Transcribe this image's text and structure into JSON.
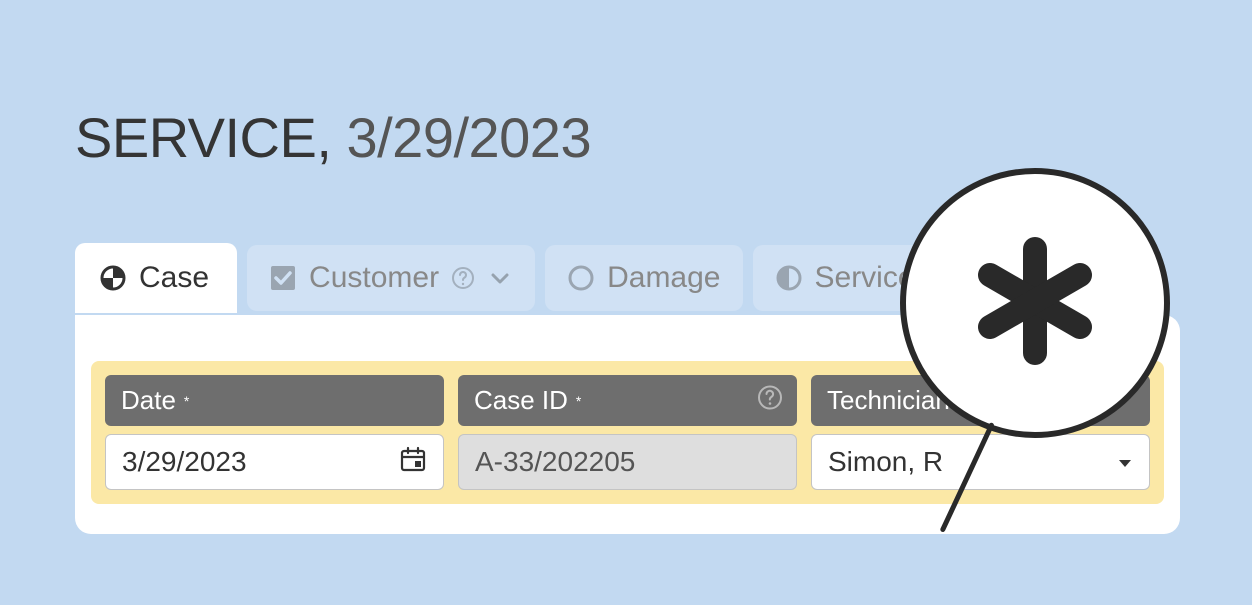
{
  "header": {
    "title_prefix": "SERVICE,",
    "title_date": "3/29/2023"
  },
  "tabs": {
    "case": "Case",
    "customer": "Customer",
    "damage": "Damage",
    "service": "Service"
  },
  "fields": {
    "date": {
      "label": "Date",
      "value": "3/29/2023",
      "required": "*"
    },
    "caseId": {
      "label": "Case ID",
      "value": "A-33/202205",
      "required": "*"
    },
    "technician": {
      "label": "Technician",
      "value": "Simon, R",
      "required": "*"
    }
  }
}
